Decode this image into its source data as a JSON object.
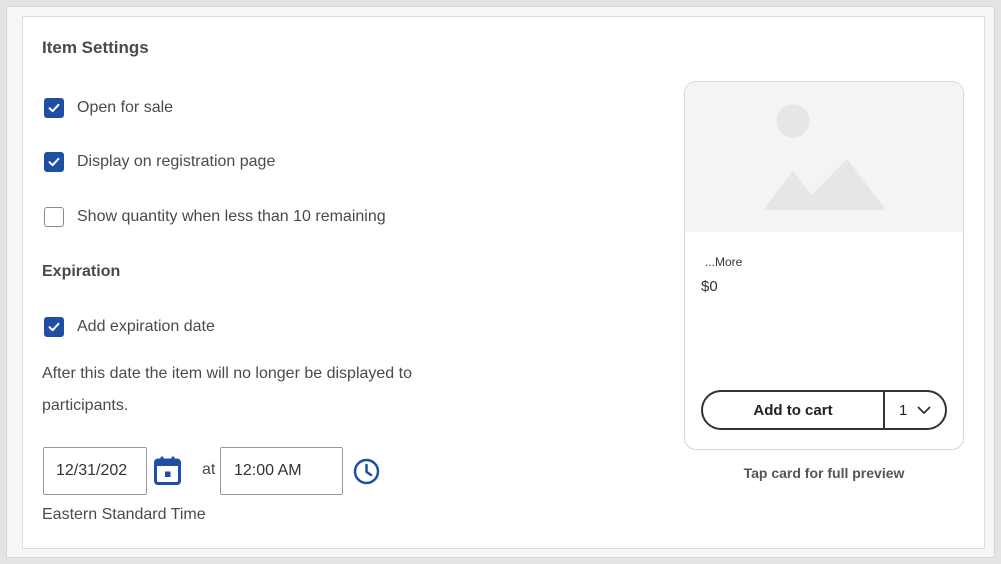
{
  "section": {
    "title": "Item Settings"
  },
  "options": [
    {
      "label": "Open for sale",
      "checked": true
    },
    {
      "label": "Display on registration page",
      "checked": true
    },
    {
      "label": "Show quantity when less than 10 remaining",
      "checked": false
    }
  ],
  "expiration": {
    "title": "Expiration",
    "add_label": "Add expiration date",
    "add_checked": true,
    "description": "After this date the item will no longer be displayed to participants.",
    "date_value": "12/31/202",
    "at_label": "at",
    "time_value": "12:00 AM",
    "timezone": "Eastern Standard Time"
  },
  "preview": {
    "more_label": "...More",
    "price": "$0",
    "add_to_cart": "Add to cart",
    "quantity": "1",
    "hint": "Tap card for full preview"
  },
  "colors": {
    "accent": "#1f4fa3",
    "placeholder": "#e9e9e9"
  },
  "icons": [
    "check-icon",
    "calendar-icon",
    "clock-icon",
    "image-placeholder-icon",
    "chevron-down-icon"
  ]
}
